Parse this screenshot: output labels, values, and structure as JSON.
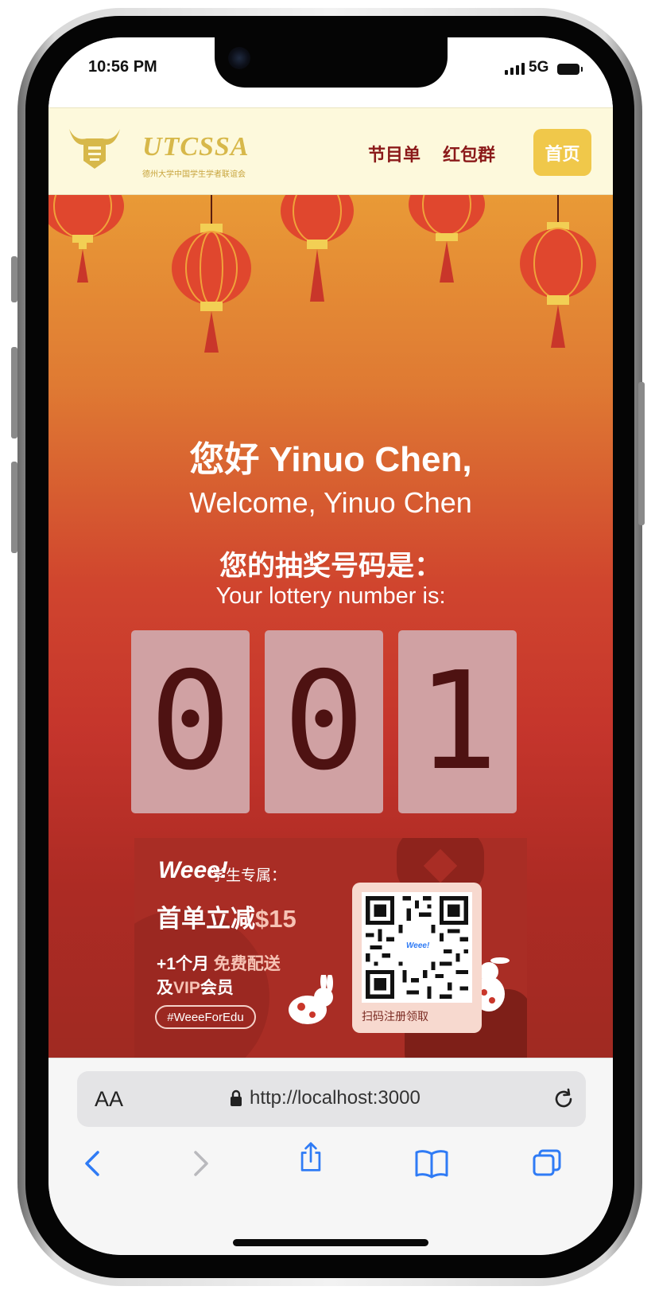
{
  "status_bar": {
    "time": "10:56 PM",
    "network": "5G"
  },
  "header": {
    "logo_text": "UTCSSA",
    "logo_subtitle": "德州大学中国学生学者联谊会",
    "nav": {
      "program": "节目单",
      "red_packet_group": "红包群",
      "home": "首页"
    }
  },
  "greeting": {
    "chinese": "您好 Yinuo Chen,",
    "english": "Welcome, Yinuo Chen"
  },
  "lottery": {
    "label_zh": "您的抽奖号码是：",
    "label_en": "Your lottery number is:",
    "digits": [
      "0",
      "0",
      "1"
    ]
  },
  "ad": {
    "brand": "Weee!",
    "headline1": "学生专属：",
    "headline2_prefix": "首单立减",
    "headline2_amount": "$15",
    "line3_prefix": "+1个月 ",
    "line3_highlight": "免费配送",
    "line4_prefix": "及",
    "line4_highlight": "VIP",
    "line4_suffix": "会员",
    "hashtag": "#WeeeForEdu",
    "qr_brand": "Weee!",
    "qr_caption": "扫码注册领取"
  },
  "browser": {
    "text_size_label": "AA",
    "url": "http://localhost:3000"
  },
  "colors": {
    "header_bg": "#fdf9dc",
    "nav_text": "#8b1a1a",
    "home_button": "#f0c84a",
    "digit_tile": "#d0a1a3",
    "digit_text": "#4e1212",
    "ios_blue": "#2f7bf5"
  }
}
